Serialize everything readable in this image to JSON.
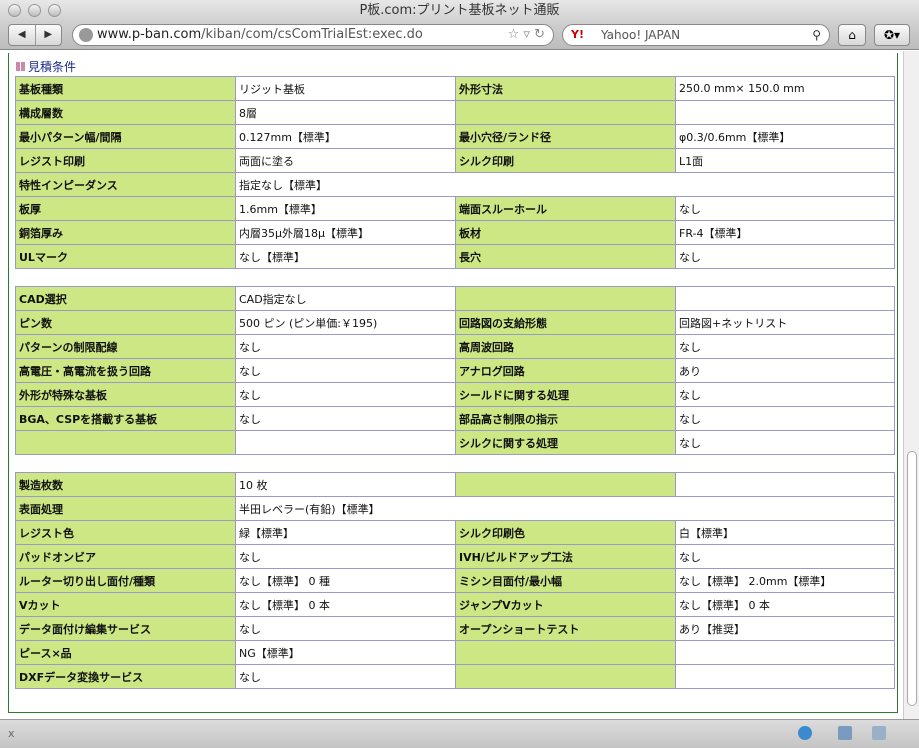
{
  "window": {
    "title": "P板.com:プリント基板ネット通販"
  },
  "toolbar": {
    "back": "◀",
    "forward": "▶",
    "url_host": "www.p-ban.com",
    "url_path": "/kiban/com/csComTrialEst:exec.do",
    "search_engine": "Y!",
    "search_text": "Yahoo! JAPAN",
    "home": "⌂",
    "bookmark": "✪▾"
  },
  "section": {
    "title": "見積条件"
  },
  "tables": [
    [
      [
        "基板種類",
        "リジット基板",
        "外形寸法",
        "250.0 mm× 150.0 mm"
      ],
      [
        "構成層数",
        "8層",
        "",
        ""
      ],
      [
        "最小パターン幅/間隔",
        "0.127mm【標準】",
        "最小穴径/ランド径",
        "φ0.3/0.6mm【標準】"
      ],
      [
        "レジスト印刷",
        "両面に塗る",
        "シルク印刷",
        "L1面"
      ],
      [
        "特性インピーダンス",
        "指定なし【標準】"
      ],
      [
        "板厚",
        "1.6mm【標準】",
        "端面スルーホール",
        "なし"
      ],
      [
        "銅箔厚み",
        "内層35μ外層18μ【標準】",
        "板材",
        "FR-4【標準】"
      ],
      [
        "ULマーク",
        "なし【標準】",
        "長穴",
        "なし"
      ]
    ],
    [
      [
        "CAD選択",
        "CAD指定なし",
        "",
        ""
      ],
      [
        "ピン数",
        "500 ピン (ピン単価:￥195)",
        "回路図の支給形態",
        "回路図+ネットリスト"
      ],
      [
        "パターンの制限配線",
        "なし",
        "高周波回路",
        "なし"
      ],
      [
        "高電圧・高電流を扱う回路",
        "なし",
        "アナログ回路",
        "あり"
      ],
      [
        "外形が特殊な基板",
        "なし",
        "シールドに関する処理",
        "なし"
      ],
      [
        "BGA、CSPを搭載する基板",
        "なし",
        "部品高さ制限の指示",
        "なし"
      ],
      [
        "",
        "",
        "シルクに関する処理",
        "なし"
      ]
    ],
    [
      [
        "製造枚数",
        "10 枚",
        "",
        ""
      ],
      [
        "表面処理",
        "半田レベラー(有鉛)【標準】"
      ],
      [
        "レジスト色",
        "緑【標準】",
        "シルク印刷色",
        "白【標準】"
      ],
      [
        "パッドオンビア",
        "なし",
        "IVH/ビルドアップ工法",
        "なし"
      ],
      [
        "ルーター切り出し面付/種類",
        "なし【標準】 0 種",
        "ミシン目面付/最小幅",
        "なし【標準】 2.0mm【標準】"
      ],
      [
        "Vカット",
        "なし【標準】 0 本",
        "ジャンプVカット",
        "なし【標準】 0 本"
      ],
      [
        "データ面付け編集サービス",
        "なし",
        "オープンショートテスト",
        "あり【推奨】"
      ],
      [
        "ピース×品",
        "NG【標準】",
        "",
        ""
      ],
      [
        "DXFデータ変換サービス",
        "なし",
        "",
        ""
      ]
    ]
  ],
  "statusbar": {
    "close": "x"
  },
  "colors": {
    "label_bg": "#cde784",
    "border": "#9a9ac8",
    "frame": "#2f7a2f"
  }
}
